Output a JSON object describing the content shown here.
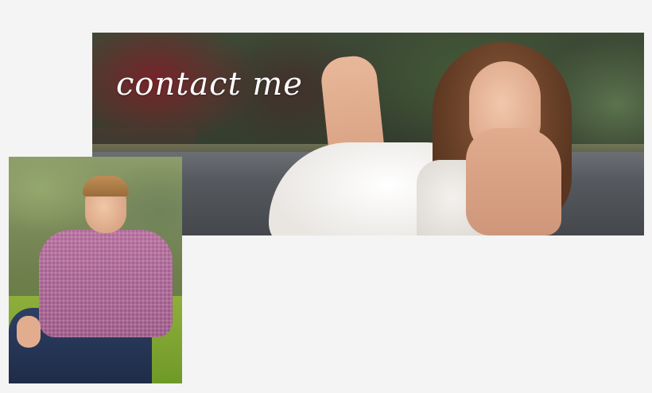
{
  "banner": {
    "title": "contact me",
    "photo": "senior-portrait-woman-lying-on-road"
  },
  "portrait": {
    "photo": "senior-portrait-man-sitting-on-grass"
  },
  "colors": {
    "background": "#f4f4f4",
    "title_text": "#ffffff"
  }
}
